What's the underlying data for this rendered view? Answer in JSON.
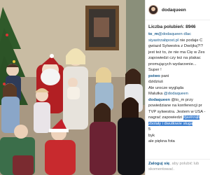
{
  "post": {
    "username": "dodaqueen",
    "likes": "Liczba polubień: 8946"
  },
  "comments": [
    {
      "user": "to_m",
      "segments": [
        {
          "t": "@dodaqueen dlac",
          "cls": "lnk"
        }
      ]
    },
    {
      "user": "",
      "segments": [
        {
          "t": "siyastrzabpost.pl",
          "cls": "lnk"
        },
        {
          "t": " nie podaje C",
          "cls": ""
        }
      ]
    },
    {
      "user": "",
      "segments": [
        {
          "t": "gwiazd Sylwestra z Dwójką?!?",
          "cls": ""
        }
      ]
    },
    {
      "user": "",
      "segments": [
        {
          "t": "jest też to, że nie ma Cię w Zes",
          "cls": ""
        }
      ]
    },
    {
      "user": "",
      "segments": [
        {
          "t": "zapowiedzi czy też na plakac",
          "cls": ""
        }
      ]
    },
    {
      "user": "",
      "segments": [
        {
          "t": "promujących wydarzenie...",
          "cls": ""
        }
      ]
    },
    {
      "user": "",
      "segments": [
        {
          "t": "Super !",
          "cls": ""
        }
      ]
    },
    {
      "user": "pstwo",
      "segments": [
        {
          "t": " pani",
          "cls": ""
        }
      ]
    },
    {
      "user": "",
      "segments": [
        {
          "t": "dzidziuś",
          "cls": ""
        }
      ]
    },
    {
      "user": "",
      "segments": [
        {
          "t": "Ale urocze wygląda",
          "cls": ""
        }
      ]
    },
    {
      "user": "",
      "segments": [
        {
          "t": "Malutka ",
          "cls": ""
        },
        {
          "t": "@dodaqueen",
          "cls": "lnk"
        }
      ]
    },
    {
      "user": "dodaqueen",
      "segments": [
        {
          "t": " @to_m przy",
          "cls": ""
        }
      ]
    },
    {
      "user": "",
      "segments": [
        {
          "t": "powiedziane na konferencji pr",
          "cls": ""
        }
      ]
    },
    {
      "user": "",
      "segments": [
        {
          "t": "TVP sylwestra. Jestem w USA -",
          "cls": ""
        }
      ]
    },
    {
      "user": "",
      "segments": [
        {
          "t": "nagrać zapowiedzi ",
          "cls": ""
        },
        {
          "t": "#jastrząb",
          "cls": "hl"
        }
      ]
    },
    {
      "user": "",
      "segments": [
        {
          "t": "zbolały i dwutłowie sługą",
          "cls": "hl"
        }
      ]
    },
    {
      "user": "",
      "segments": [
        {
          "t": "5",
          "cls": ""
        }
      ]
    },
    {
      "user": "",
      "segments": [
        {
          "t": "byk",
          "cls": ""
        }
      ]
    },
    {
      "user": "",
      "segments": [
        {
          "t": "ale piękna fota",
          "cls": ""
        }
      ]
    }
  ],
  "footer": {
    "login_link": "Zaloguj się",
    "text": ", aby polubić lub skomentować."
  },
  "colors": {
    "link": "#125688",
    "highlight": "#3d7fd0"
  }
}
